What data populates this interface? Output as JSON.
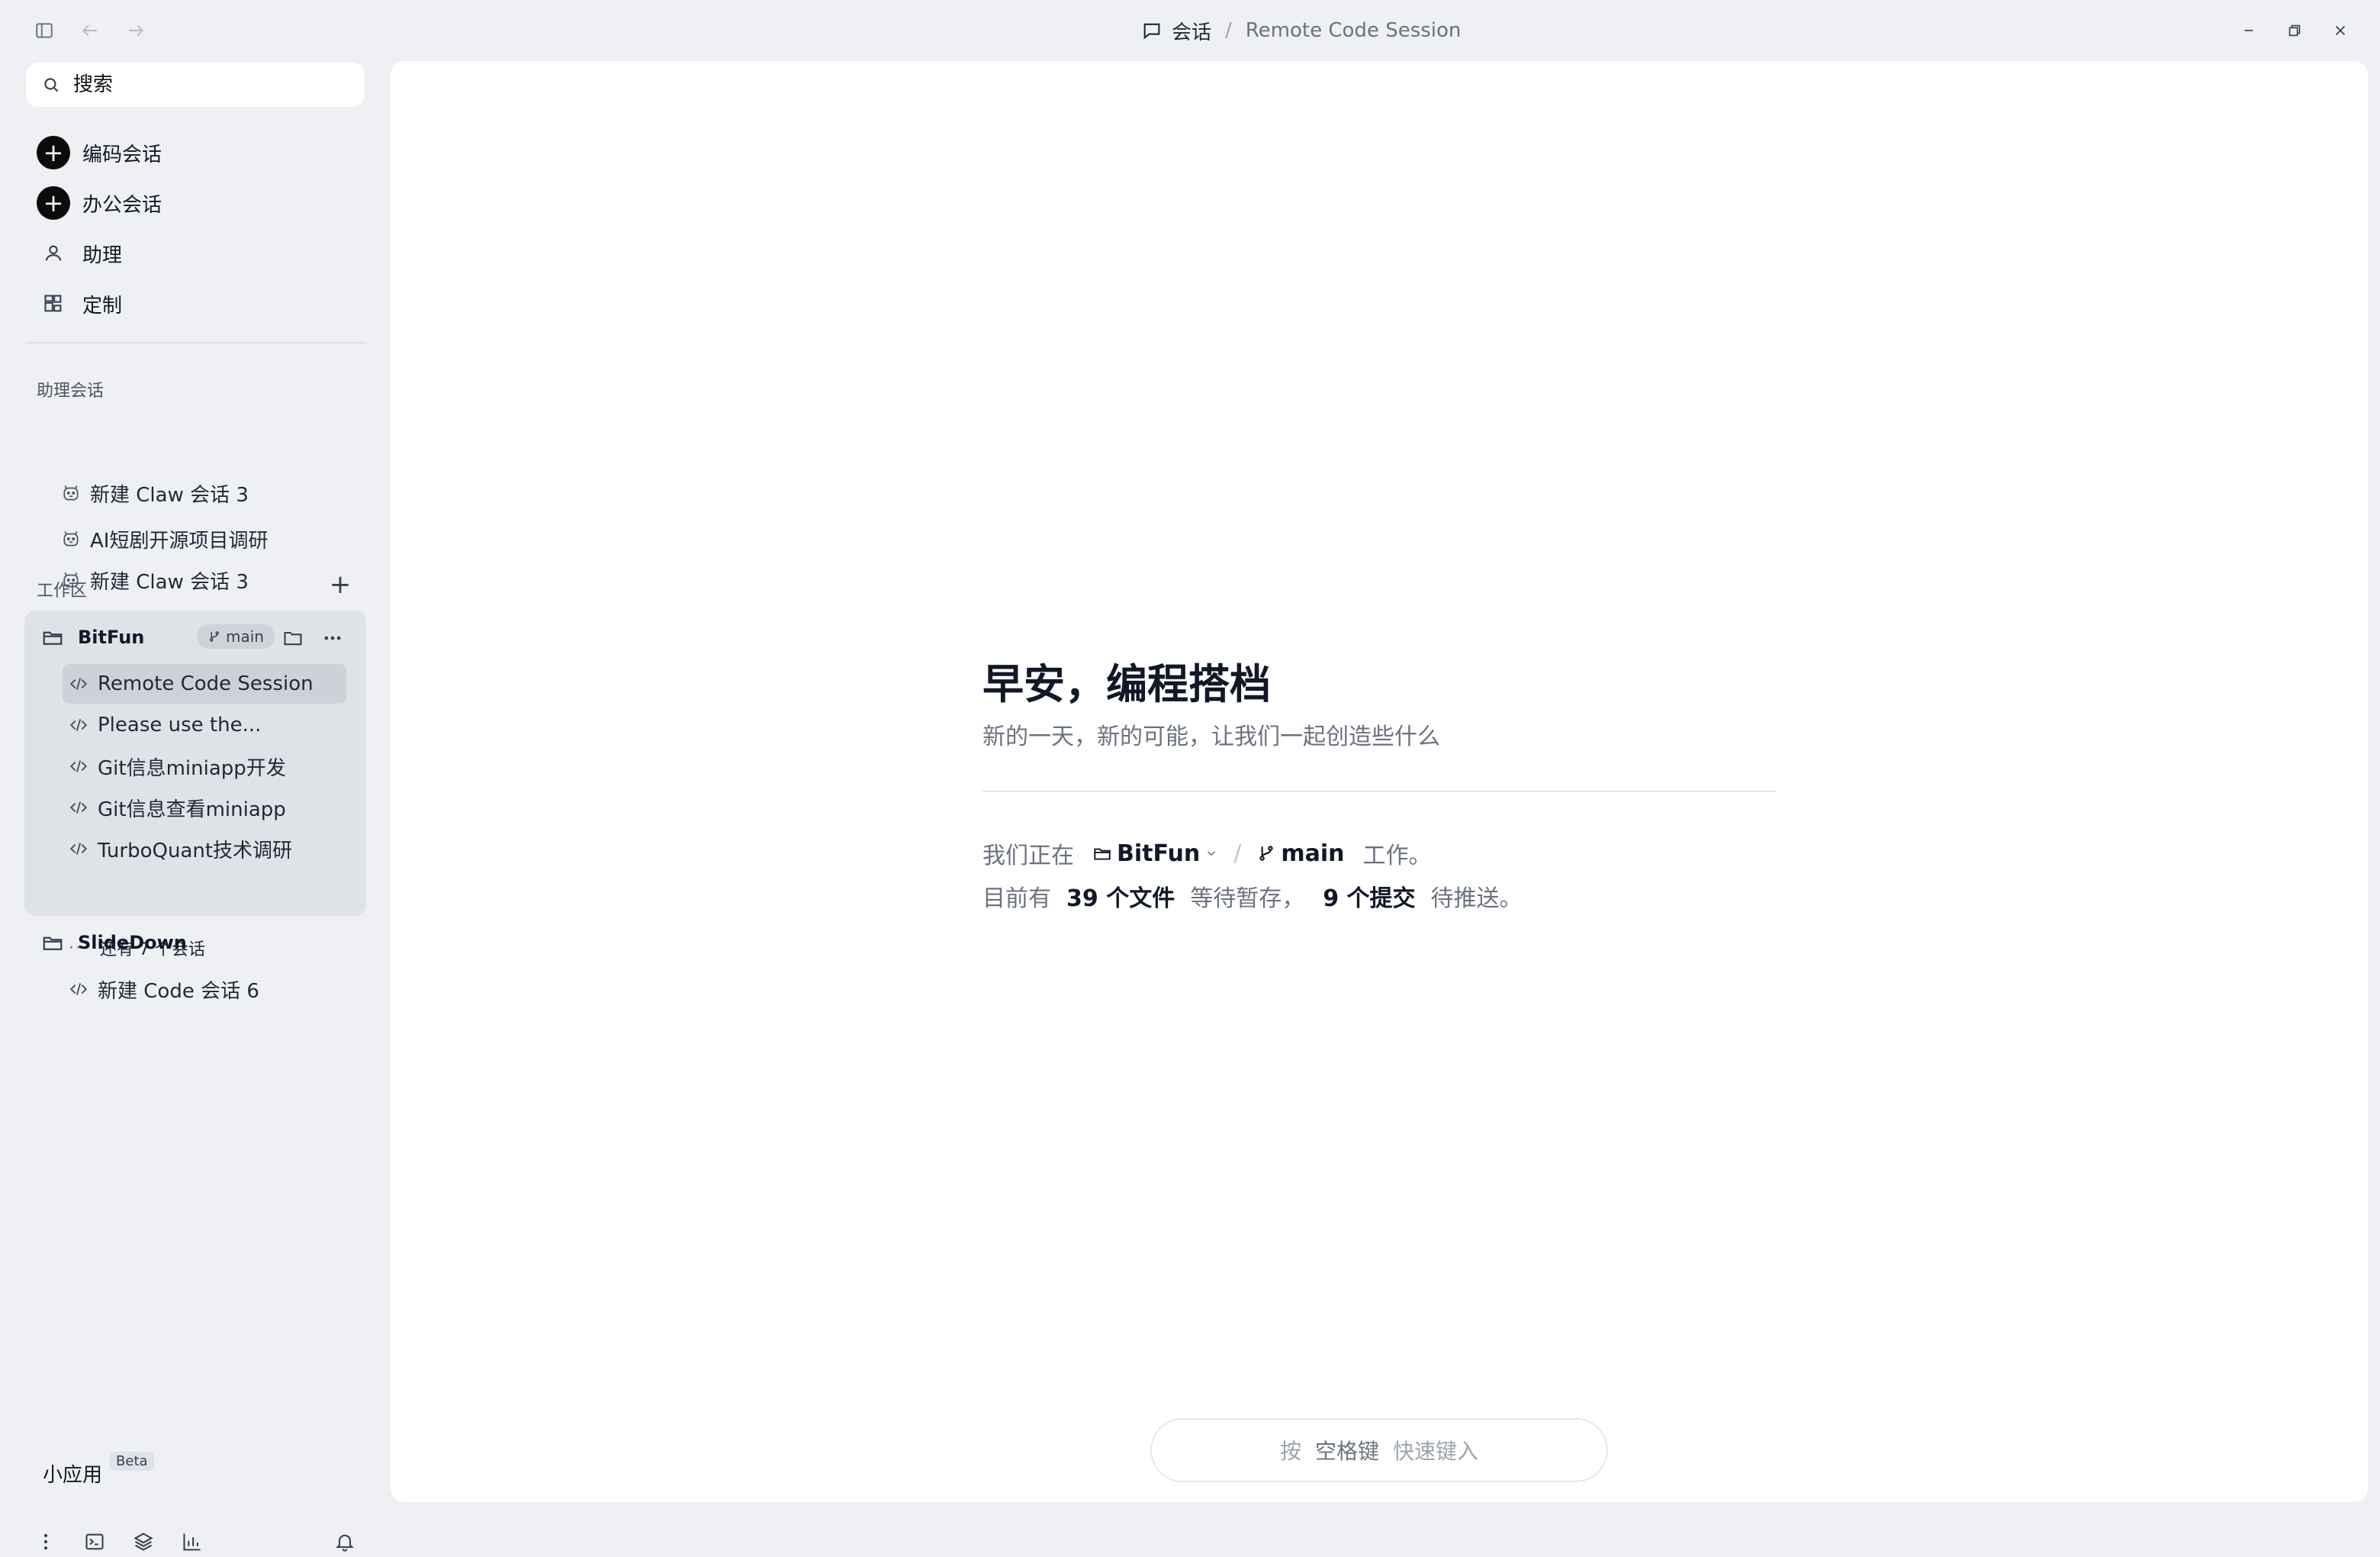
{
  "titlebar": {
    "crumb_root": "会话",
    "crumb_separator": "/",
    "crumb_current": "Remote Code Session"
  },
  "sidebar": {
    "search_placeholder": "搜索",
    "nav": [
      {
        "label": "编码会话",
        "icon": "plus-circle-icon"
      },
      {
        "label": "办公会话",
        "icon": "plus-circle-icon"
      },
      {
        "label": "助理",
        "icon": "person-icon"
      },
      {
        "label": "定制",
        "icon": "widgets-icon"
      }
    ],
    "assistant_section_label": "助理会话",
    "assistant_sessions": [
      {
        "label": "新建 Claw 会话 3"
      },
      {
        "label": "AI短剧开源项目调研"
      },
      {
        "label": "新建 Claw 会话 3"
      }
    ],
    "workspace_section_label": "工作区",
    "workspaces": [
      {
        "name": "BitFun",
        "branch": "main",
        "sessions": [
          {
            "label": "Remote Code Session",
            "active": true
          },
          {
            "label": "Please use the..."
          },
          {
            "label": "Git信息miniapp开发"
          },
          {
            "label": "Git信息查看miniapp"
          },
          {
            "label": "TurboQuant技术调研"
          }
        ],
        "more_label": "还有 7 个会话"
      },
      {
        "name": "SlideDown",
        "sessions": [
          {
            "label": "新建 Code 会话 6"
          }
        ]
      }
    ],
    "miniapp_label": "小应用",
    "miniapp_badge": "Beta"
  },
  "main": {
    "greeting_title": "早安，编程搭档",
    "greeting_subtitle": "新的一天，新的可能，让我们一起创造些什么",
    "status": {
      "working_prefix": "我们正在",
      "project": "BitFun",
      "branch": "main",
      "working_suffix": "工作。",
      "pending_prefix": "目前有",
      "files_count": "39 个文件",
      "pending_mid": "等待暂存，",
      "commits_count": "9 个提交",
      "pending_suffix": "待推送。"
    },
    "quick_input": {
      "press": "按",
      "key": "空格键",
      "action": "快速键入"
    }
  }
}
